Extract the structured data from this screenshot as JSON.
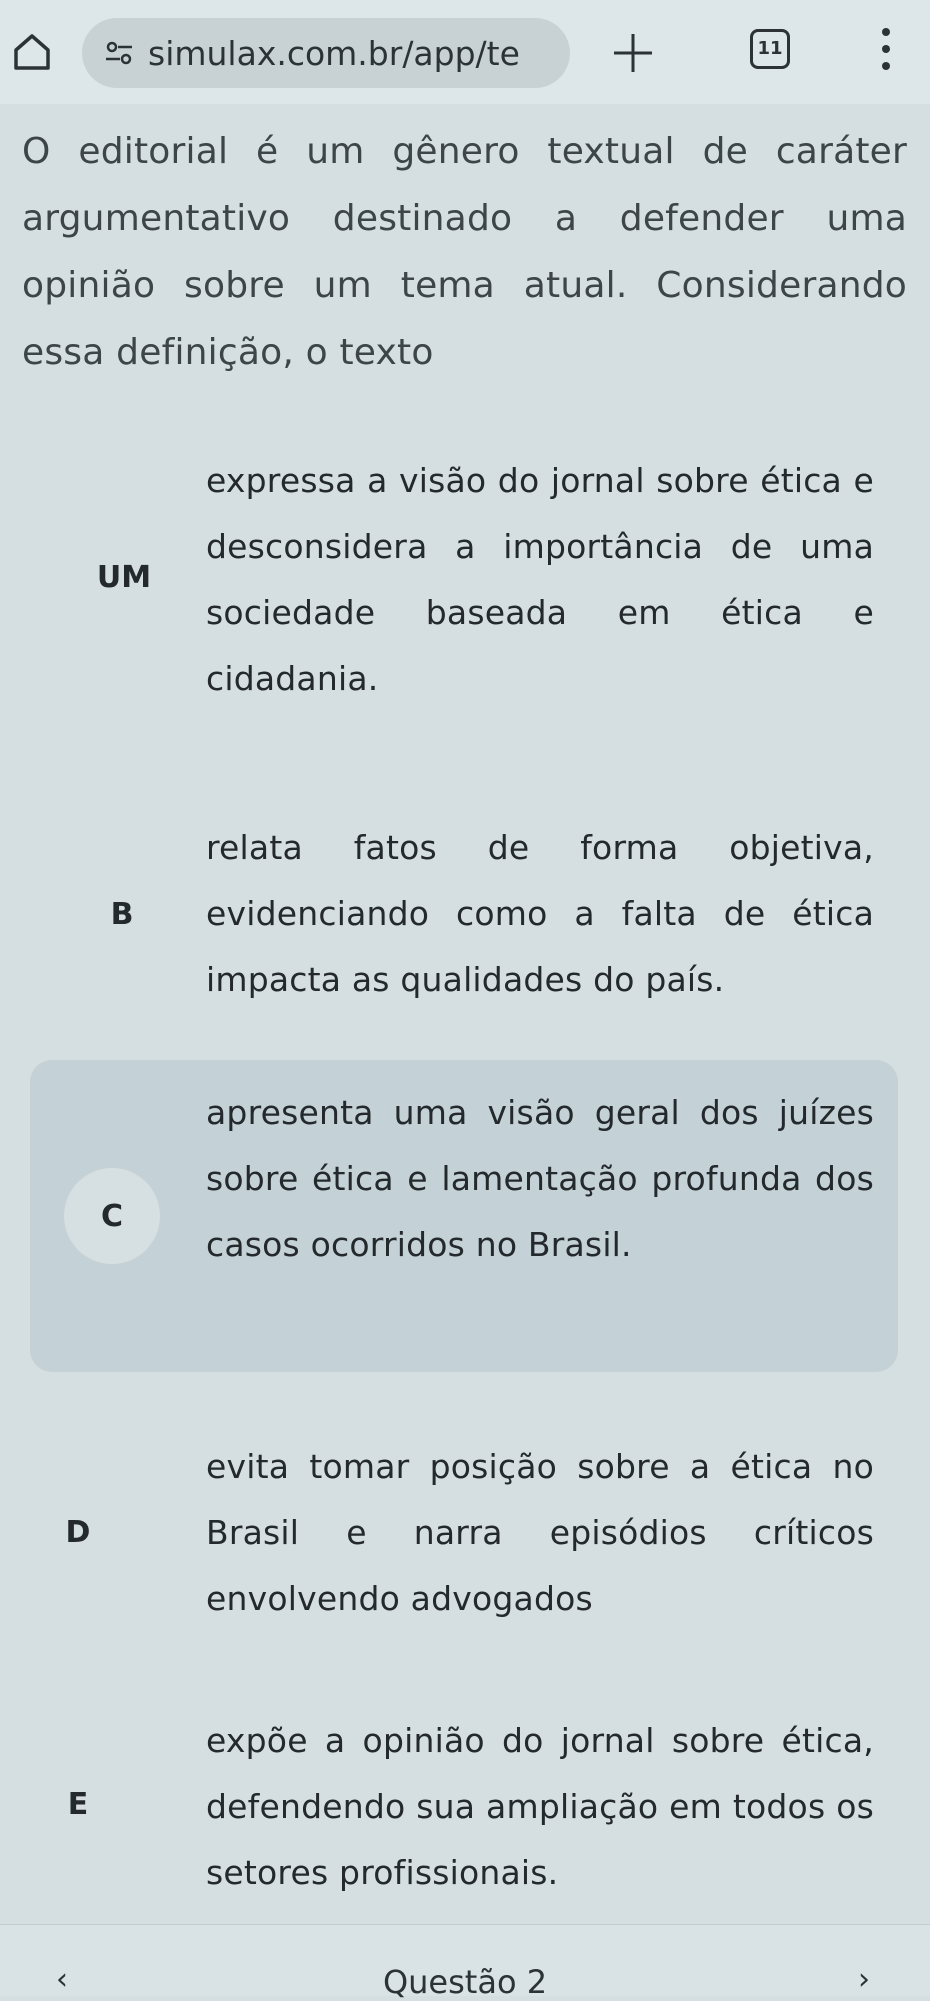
{
  "browser": {
    "url": "simulax.com.br/app/te",
    "home_icon": "home-icon",
    "site_icon": "site-settings-icon",
    "tabs_count": "11",
    "new_tab_icon": "plus-icon",
    "menu_icon": "kebab-menu-icon"
  },
  "question": {
    "text": "O editorial é um gênero textual de caráter argumentativo destinado a defender uma opinião sobre um tema atual. Considerando essa definição, o texto"
  },
  "options": [
    {
      "letter": "UM",
      "text": "expressa a visão do jornal sobre ética e desconsidera a importância de uma sociedade baseada em ética e cidadania.",
      "selected": false
    },
    {
      "letter": "B",
      "text": "relata fatos de forma objetiva, evidenciando como a falta de ética impacta as qualidades do país.",
      "selected": false
    },
    {
      "letter": "C",
      "text": "apresenta uma visão geral dos juízes sobre ética e lamentação profunda dos casos ocorridos no Brasil.",
      "selected": true
    },
    {
      "letter": "D",
      "text": "evita tomar posição sobre a ética no Brasil e narra episódios críticos envolvendo advogados",
      "selected": false
    },
    {
      "letter": "E",
      "text": "expõe a opinião do jornal sobre ética, defendendo sua ampliação em todos os setores profissionais.",
      "selected": false
    }
  ],
  "bottom_nav": {
    "title": "Questão 2",
    "prev_label": "‹",
    "next_label": "›"
  },
  "colors": {
    "background": "#d5dfe2",
    "selected_option": "#c4d1d6",
    "text": "#23292c"
  }
}
